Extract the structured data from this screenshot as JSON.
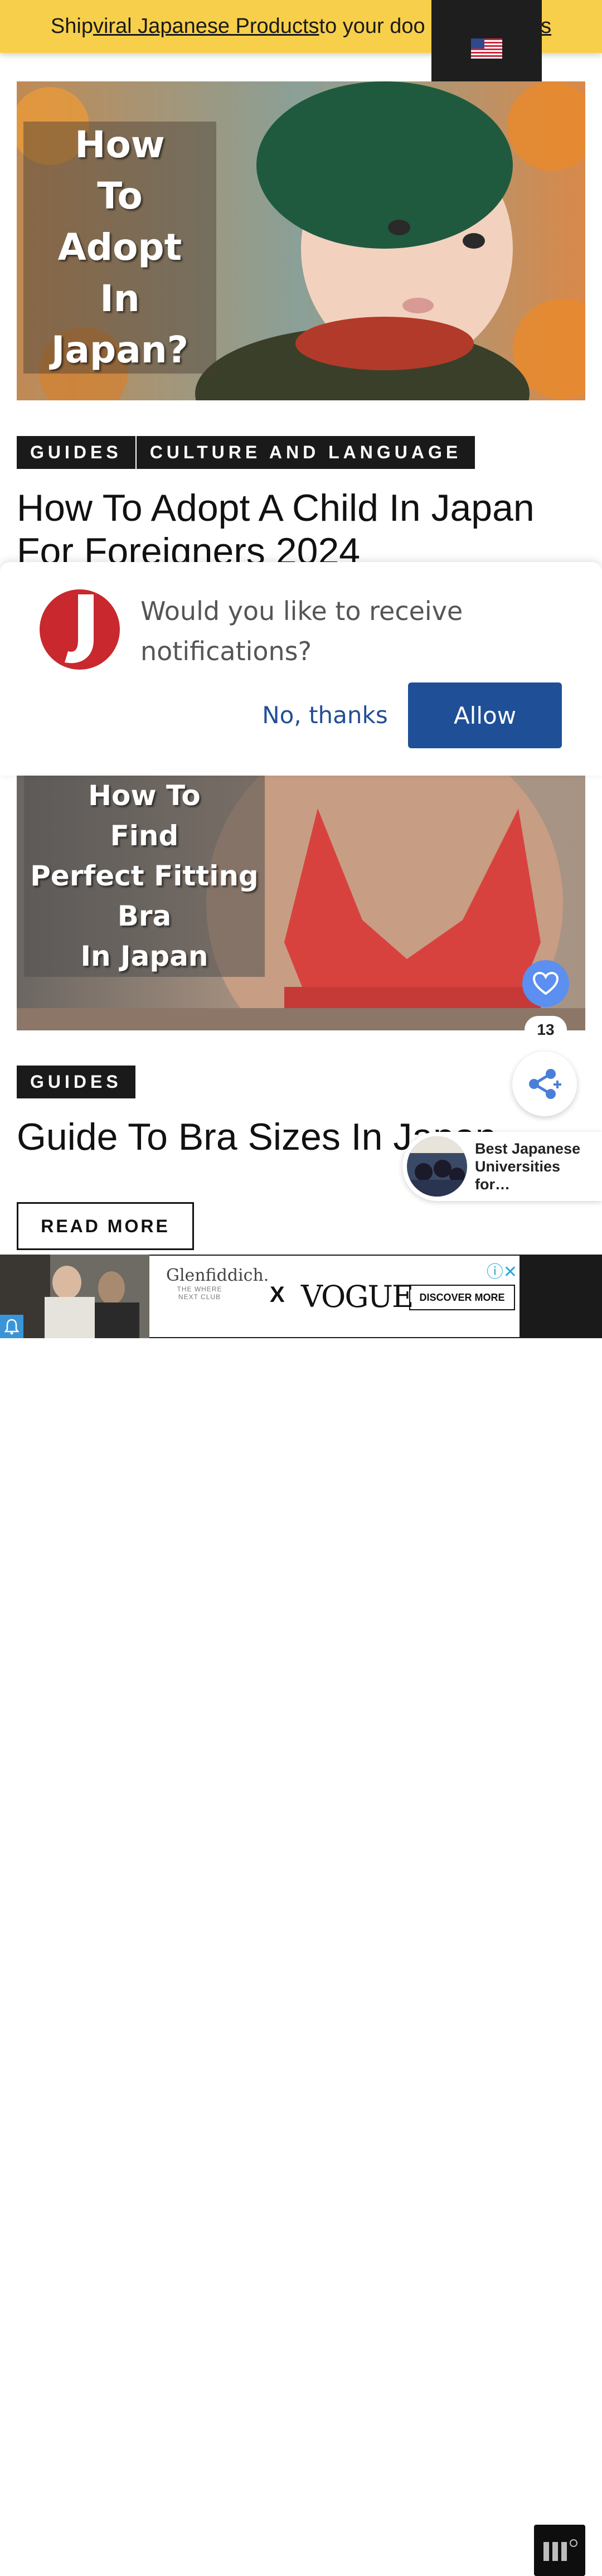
{
  "banner": {
    "prefix": "Ship ",
    "link": "viral Japanese Products ",
    "suffix": "to your doo",
    "tail": "iss"
  },
  "language_flag": {
    "icon": "us-flag-icon",
    "label": ""
  },
  "articles": [
    {
      "overlay_text": "How\nTo\nAdopt\nIn\nJapan?",
      "tags": [
        "GUIDES",
        "CULTURE AND LANGUAGE"
      ],
      "title": "How To Adopt A Child In Japan For Foreigners 2024"
    },
    {
      "overlay_text": "How To\nFind\nPerfect Fitting\nBra\nIn Japan",
      "tags": [
        "GUIDES"
      ],
      "title": "Guide To Bra Sizes In Japan",
      "read_more": "READ MORE"
    }
  ],
  "notification": {
    "message": "Would you like to receive notifications?",
    "deny": "No, thanks",
    "allow": "Allow",
    "accent": "#1f4f97"
  },
  "social": {
    "count": "13",
    "heart_color": "#5b8ff0"
  },
  "related_popup": {
    "title": "Best Japanese Universities for…"
  },
  "ad": {
    "brand1": "Glenfiddich.",
    "brand1_sub": "THE WHERE NEXT CLUB",
    "x": "X",
    "brand2": "VOGUE",
    "cta": "DISCOVER MORE"
  },
  "colors": {
    "banner": "#f8cf4a",
    "tag_bg": "#1a1a1a"
  }
}
